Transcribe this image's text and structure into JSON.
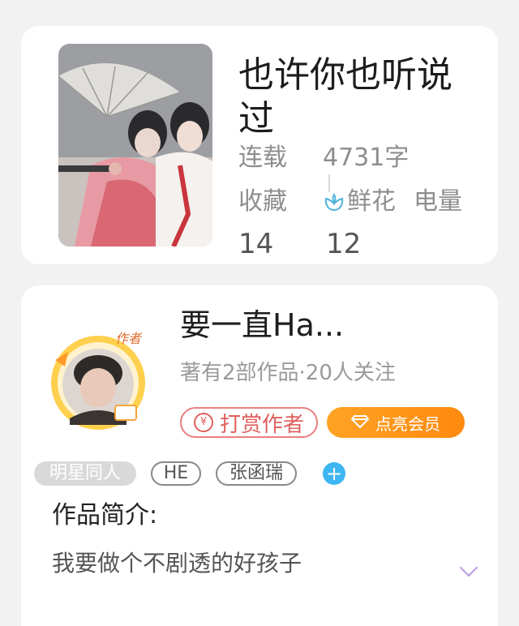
{
  "book": {
    "title": "也许你也听说过",
    "status": "连载",
    "word_count": "4731字",
    "stats": [
      {
        "label": "收藏",
        "value": "14"
      },
      {
        "label": "鲜花",
        "value": "12"
      },
      {
        "label": "电量",
        "value": ""
      }
    ]
  },
  "author": {
    "name": "要一直Ha...",
    "badge": "作者",
    "meta": "著有2部作品·20人关注",
    "reward_label": "打赏作者",
    "vip_label": "点亮会员"
  },
  "tags": [
    "明星同人",
    "HE",
    "张函瑞"
  ],
  "intro": {
    "heading": "作品简介:",
    "text": "我要做个不剧透的好孩子"
  },
  "colors": {
    "accent_orange": "#ff8a0f",
    "reward_red": "#e0605f",
    "add_blue": "#3db6f2"
  }
}
